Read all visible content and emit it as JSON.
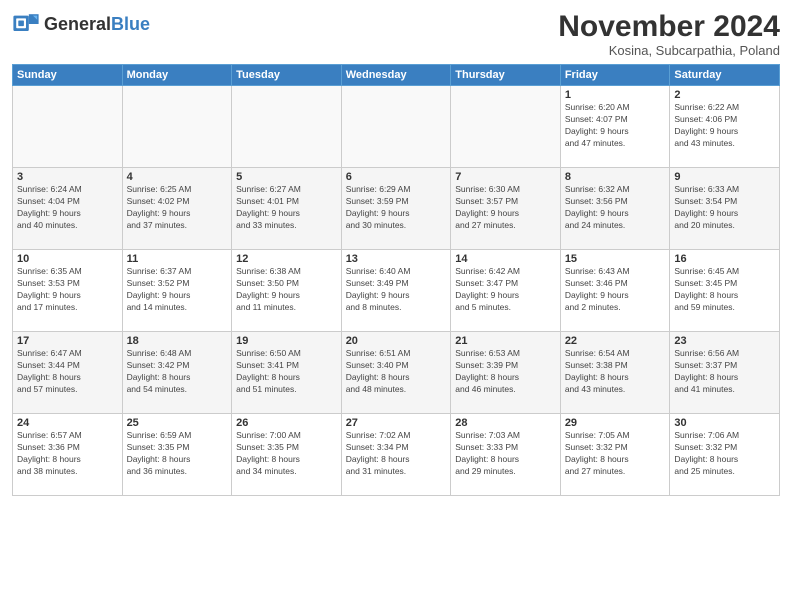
{
  "header": {
    "logo_general": "General",
    "logo_blue": "Blue",
    "month_title": "November 2024",
    "location": "Kosina, Subcarpathia, Poland"
  },
  "weekdays": [
    "Sunday",
    "Monday",
    "Tuesday",
    "Wednesday",
    "Thursday",
    "Friday",
    "Saturday"
  ],
  "weeks": [
    [
      {
        "day": "",
        "info": ""
      },
      {
        "day": "",
        "info": ""
      },
      {
        "day": "",
        "info": ""
      },
      {
        "day": "",
        "info": ""
      },
      {
        "day": "",
        "info": ""
      },
      {
        "day": "1",
        "info": "Sunrise: 6:20 AM\nSunset: 4:07 PM\nDaylight: 9 hours\nand 47 minutes."
      },
      {
        "day": "2",
        "info": "Sunrise: 6:22 AM\nSunset: 4:06 PM\nDaylight: 9 hours\nand 43 minutes."
      }
    ],
    [
      {
        "day": "3",
        "info": "Sunrise: 6:24 AM\nSunset: 4:04 PM\nDaylight: 9 hours\nand 40 minutes."
      },
      {
        "day": "4",
        "info": "Sunrise: 6:25 AM\nSunset: 4:02 PM\nDaylight: 9 hours\nand 37 minutes."
      },
      {
        "day": "5",
        "info": "Sunrise: 6:27 AM\nSunset: 4:01 PM\nDaylight: 9 hours\nand 33 minutes."
      },
      {
        "day": "6",
        "info": "Sunrise: 6:29 AM\nSunset: 3:59 PM\nDaylight: 9 hours\nand 30 minutes."
      },
      {
        "day": "7",
        "info": "Sunrise: 6:30 AM\nSunset: 3:57 PM\nDaylight: 9 hours\nand 27 minutes."
      },
      {
        "day": "8",
        "info": "Sunrise: 6:32 AM\nSunset: 3:56 PM\nDaylight: 9 hours\nand 24 minutes."
      },
      {
        "day": "9",
        "info": "Sunrise: 6:33 AM\nSunset: 3:54 PM\nDaylight: 9 hours\nand 20 minutes."
      }
    ],
    [
      {
        "day": "10",
        "info": "Sunrise: 6:35 AM\nSunset: 3:53 PM\nDaylight: 9 hours\nand 17 minutes."
      },
      {
        "day": "11",
        "info": "Sunrise: 6:37 AM\nSunset: 3:52 PM\nDaylight: 9 hours\nand 14 minutes."
      },
      {
        "day": "12",
        "info": "Sunrise: 6:38 AM\nSunset: 3:50 PM\nDaylight: 9 hours\nand 11 minutes."
      },
      {
        "day": "13",
        "info": "Sunrise: 6:40 AM\nSunset: 3:49 PM\nDaylight: 9 hours\nand 8 minutes."
      },
      {
        "day": "14",
        "info": "Sunrise: 6:42 AM\nSunset: 3:47 PM\nDaylight: 9 hours\nand 5 minutes."
      },
      {
        "day": "15",
        "info": "Sunrise: 6:43 AM\nSunset: 3:46 PM\nDaylight: 9 hours\nand 2 minutes."
      },
      {
        "day": "16",
        "info": "Sunrise: 6:45 AM\nSunset: 3:45 PM\nDaylight: 8 hours\nand 59 minutes."
      }
    ],
    [
      {
        "day": "17",
        "info": "Sunrise: 6:47 AM\nSunset: 3:44 PM\nDaylight: 8 hours\nand 57 minutes."
      },
      {
        "day": "18",
        "info": "Sunrise: 6:48 AM\nSunset: 3:42 PM\nDaylight: 8 hours\nand 54 minutes."
      },
      {
        "day": "19",
        "info": "Sunrise: 6:50 AM\nSunset: 3:41 PM\nDaylight: 8 hours\nand 51 minutes."
      },
      {
        "day": "20",
        "info": "Sunrise: 6:51 AM\nSunset: 3:40 PM\nDaylight: 8 hours\nand 48 minutes."
      },
      {
        "day": "21",
        "info": "Sunrise: 6:53 AM\nSunset: 3:39 PM\nDaylight: 8 hours\nand 46 minutes."
      },
      {
        "day": "22",
        "info": "Sunrise: 6:54 AM\nSunset: 3:38 PM\nDaylight: 8 hours\nand 43 minutes."
      },
      {
        "day": "23",
        "info": "Sunrise: 6:56 AM\nSunset: 3:37 PM\nDaylight: 8 hours\nand 41 minutes."
      }
    ],
    [
      {
        "day": "24",
        "info": "Sunrise: 6:57 AM\nSunset: 3:36 PM\nDaylight: 8 hours\nand 38 minutes."
      },
      {
        "day": "25",
        "info": "Sunrise: 6:59 AM\nSunset: 3:35 PM\nDaylight: 8 hours\nand 36 minutes."
      },
      {
        "day": "26",
        "info": "Sunrise: 7:00 AM\nSunset: 3:35 PM\nDaylight: 8 hours\nand 34 minutes."
      },
      {
        "day": "27",
        "info": "Sunrise: 7:02 AM\nSunset: 3:34 PM\nDaylight: 8 hours\nand 31 minutes."
      },
      {
        "day": "28",
        "info": "Sunrise: 7:03 AM\nSunset: 3:33 PM\nDaylight: 8 hours\nand 29 minutes."
      },
      {
        "day": "29",
        "info": "Sunrise: 7:05 AM\nSunset: 3:32 PM\nDaylight: 8 hours\nand 27 minutes."
      },
      {
        "day": "30",
        "info": "Sunrise: 7:06 AM\nSunset: 3:32 PM\nDaylight: 8 hours\nand 25 minutes."
      }
    ]
  ]
}
